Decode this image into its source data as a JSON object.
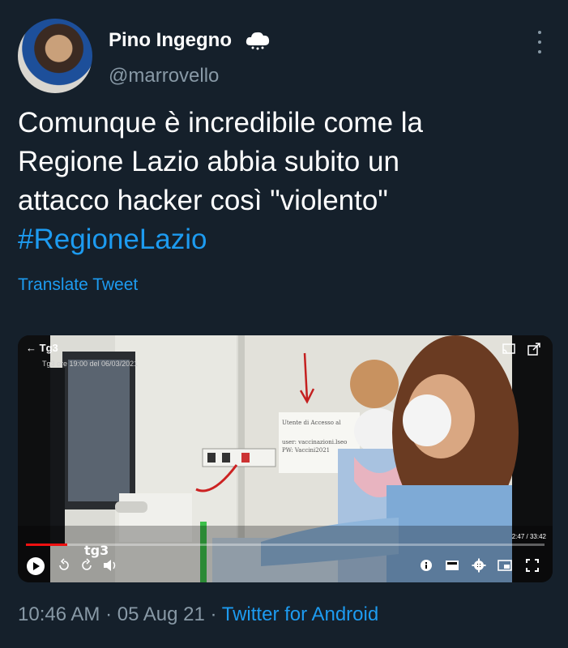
{
  "author": {
    "display_name": "Pino Ingegno",
    "handle": "@marrovello",
    "badge_icon": "cloud-icon"
  },
  "tweet": {
    "lines": [
      "Comunque è incredibile come la",
      "Regione Lazio abbia subito un",
      "attacco hacker così \"violento\""
    ],
    "hashtag": "#RegioneLazio",
    "translate_label": "Translate Tweet"
  },
  "media": {
    "channel": "Tg3",
    "subtitle": "Tg3 ore 19:00 del 06/03/2021",
    "logo": "tg3",
    "time": "2:47 / 33:42",
    "progress": 0.08,
    "note_lines": [
      "Utente di Accesso al",
      "user: vaccinazioni.lseo",
      "PW: Vaccini2021"
    ]
  },
  "footer": {
    "time": "10:46 AM",
    "date": "05 Aug 21",
    "separator": "·",
    "source": "Twitter for Android"
  },
  "colors": {
    "background": "#15202b",
    "accent": "#1d9bf0",
    "secondary_text": "#8899a6"
  }
}
